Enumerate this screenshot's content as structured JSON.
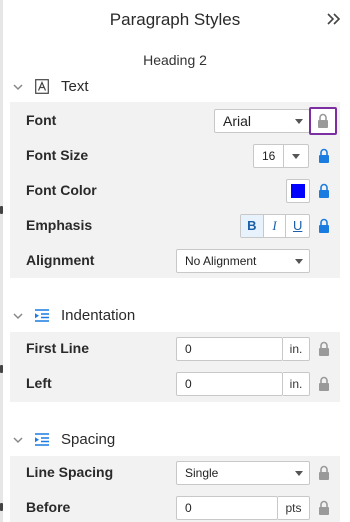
{
  "panel": {
    "title": "Paragraph Styles",
    "style_name": "Heading 2"
  },
  "text_section": {
    "label": "Text",
    "font": {
      "label": "Font",
      "value": "Arial"
    },
    "font_size": {
      "label": "Font Size",
      "value": "16"
    },
    "font_color": {
      "label": "Font Color",
      "color": "#0000ff"
    },
    "emphasis": {
      "label": "Emphasis",
      "bold": "B",
      "italic": "I",
      "underline": "U"
    },
    "alignment": {
      "label": "Alignment",
      "value": "No Alignment"
    }
  },
  "indentation_section": {
    "label": "Indentation",
    "first_line": {
      "label": "First Line",
      "value": "0",
      "unit": "in."
    },
    "left": {
      "label": "Left",
      "value": "0",
      "unit": "in."
    }
  },
  "spacing_section": {
    "label": "Spacing",
    "line_spacing": {
      "label": "Line Spacing",
      "value": "Single"
    },
    "before": {
      "label": "Before",
      "value": "0",
      "unit": "pts"
    }
  },
  "colors": {
    "lock_active": "#1a7ce0",
    "lock_inactive": "#9a9a9a",
    "highlight": "#7b2fa3"
  }
}
